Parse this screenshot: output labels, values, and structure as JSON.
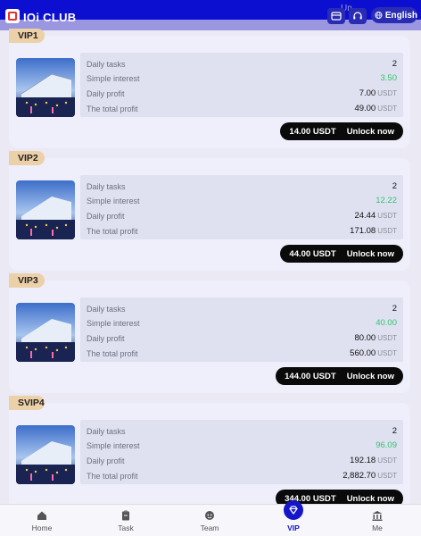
{
  "header": {
    "app_title": "IOi CLUB",
    "faded_text": "Un",
    "language": "English"
  },
  "labels": {
    "daily_tasks": "Daily tasks",
    "simple_interest": "Simple interest",
    "daily_profit": "Daily profit",
    "total_profit": "The total profit",
    "unit": "USDT",
    "unlock": "Unlock now"
  },
  "cards": [
    {
      "tag": "VIP1",
      "daily_tasks": "2",
      "simple_interest": "3.50",
      "daily_profit": "7.00",
      "total_profit": "49.00",
      "price": "14.00 USDT"
    },
    {
      "tag": "VIP2",
      "daily_tasks": "2",
      "simple_interest": "12.22",
      "daily_profit": "24.44",
      "total_profit": "171.08",
      "price": "44.00 USDT"
    },
    {
      "tag": "VIP3",
      "daily_tasks": "2",
      "simple_interest": "40.00",
      "daily_profit": "80.00",
      "total_profit": "560.00",
      "price": "144.00 USDT"
    },
    {
      "tag": "SVIP4",
      "daily_tasks": "2",
      "simple_interest": "96.09",
      "daily_profit": "192.18",
      "total_profit": "2,882.70",
      "price": "344.00 USDT"
    }
  ],
  "tabs": [
    {
      "label": "Home",
      "icon": "home-icon"
    },
    {
      "label": "Task",
      "icon": "clipboard-icon"
    },
    {
      "label": "Team",
      "icon": "team-icon"
    },
    {
      "label": "VIP",
      "icon": "diamond-icon",
      "active": true
    },
    {
      "label": "Me",
      "icon": "bank-icon"
    }
  ],
  "colors": {
    "header_bg": "#0d0fd0",
    "accent": "#1416c8",
    "interest_green": "#35c46e",
    "tag_bg": "#ebd0a8"
  }
}
